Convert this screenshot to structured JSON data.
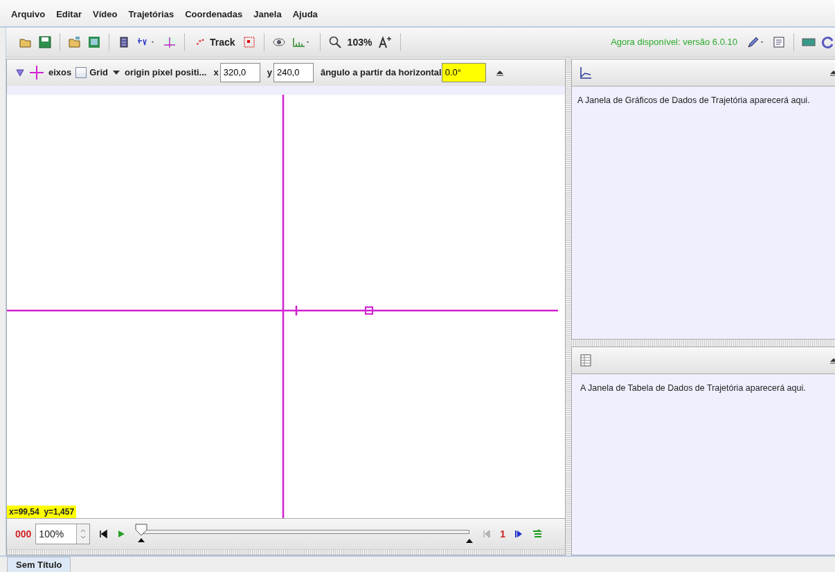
{
  "menu": [
    "Arquivo",
    "Editar",
    "Vídeo",
    "Trajetórias",
    "Coordenadas",
    "Janela",
    "Ajuda"
  ],
  "toolbar": {
    "track_label": "Track",
    "zoom": "103%",
    "notice": "Agora disponível: versão 6.0.10"
  },
  "axes_bar": {
    "axes_label": "eixos",
    "grid": {
      "label": "Grid",
      "checked": false
    },
    "origin_label": "origin pixel positi...",
    "x_label": "x",
    "x_value": "320,0",
    "y_label": "y",
    "y_value": "240,0",
    "angle_label": "ângulo a partir da horizontal",
    "angle_value": "0.0°"
  },
  "readout": "x=99,54  y=1,457",
  "player": {
    "frame": "000",
    "rate": "100%",
    "level": 0,
    "step": "1"
  },
  "panels": [
    {
      "kind": "graph",
      "message": "A Janela de Gráficos de Dados de Trajetória aparecerá aqui."
    },
    {
      "kind": "table",
      "message": "A Janela de Tabela de Dados de Trajetória aparecerá aqui."
    }
  ],
  "tabs": [
    {
      "label": "Sem Título",
      "selected": true
    }
  ]
}
